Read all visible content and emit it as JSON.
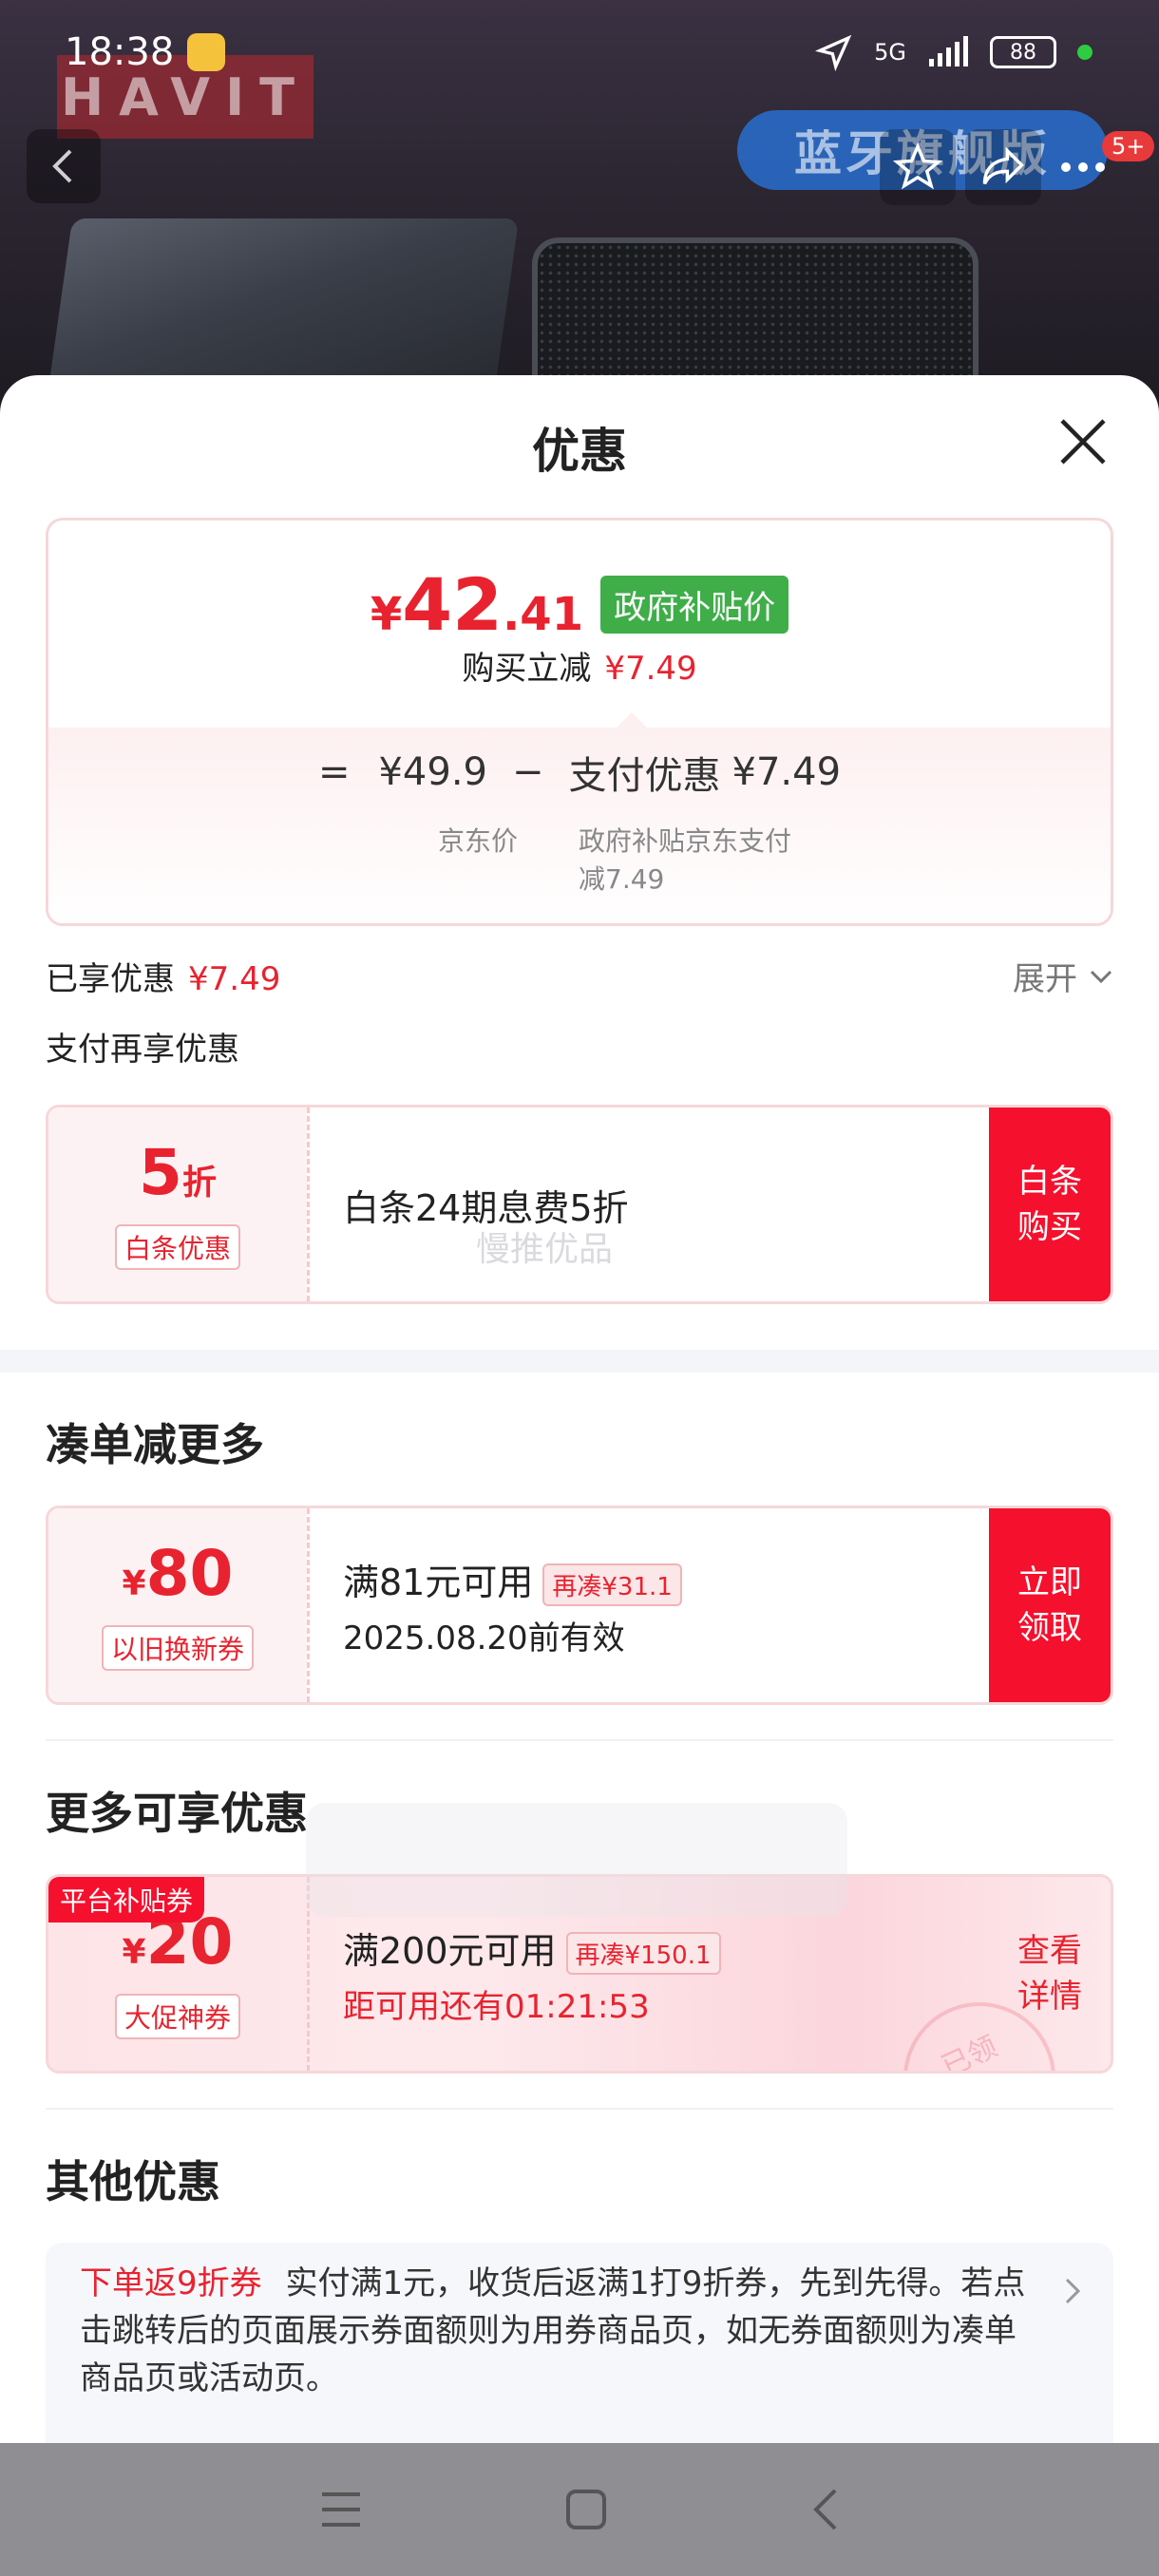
{
  "status_bar": {
    "time": "18:38",
    "network": "5G",
    "battery": "88"
  },
  "header": {
    "brand_logo_text": "HAVIT",
    "shop_tag": "蓝牙旗舰版",
    "more_badge": "5+"
  },
  "sheet": {
    "title": "优惠"
  },
  "price_card": {
    "yen": "¥",
    "price_int": "42",
    "price_dec": ".41",
    "price_tag": "政府补贴价",
    "instant_label": "购买立减",
    "instant_value": "¥7.49",
    "eq": "=",
    "jd_price": "¥49.9",
    "jd_price_label": "京东价",
    "minus": "−",
    "pay_discount_label": "支付优惠",
    "pay_discount_value": "¥7.49",
    "pay_discount_desc": "政府补贴京东支付减7.49"
  },
  "enjoyed": {
    "label": "已享优惠",
    "value": "¥7.49",
    "expand": "展开"
  },
  "pay_more": {
    "title": "支付再享优惠",
    "coupon": {
      "big": "5",
      "unit": "折",
      "tag": "白条优惠",
      "desc": "白条24期息费5折",
      "button": "白条购买",
      "watermark": "慢推优品"
    }
  },
  "bundle": {
    "title": "凑单减更多",
    "coupon": {
      "yen": "¥",
      "amount": "80",
      "tag": "以旧换新券",
      "condition": "满81元可用",
      "re_tag": "再凑¥31.1",
      "expiry": "2025.08.20前有效",
      "button": "立即领取"
    }
  },
  "more_offers": {
    "title": "更多可享优惠",
    "coupon": {
      "platform_tag": "平台补贴券",
      "yen": "¥",
      "amount": "20",
      "tag": "大促神券",
      "condition": "满200元可用",
      "re_tag": "再凑¥150.1",
      "countdown": "距可用还有01:21:53",
      "button": "查看详情",
      "stamp": "已领"
    }
  },
  "other": {
    "title": "其他优惠",
    "highlight": "下单返9折券",
    "text": "实付满1元，收货后返满1打9折券，先到先得。若点击跳转后的页面展示券面额则为用券商品页，如无券面额则为凑单商品页或活动页。"
  },
  "colors": {
    "accent_red": "#e8232f",
    "button_red": "#f5102d",
    "gov_green": "#3fae49"
  }
}
